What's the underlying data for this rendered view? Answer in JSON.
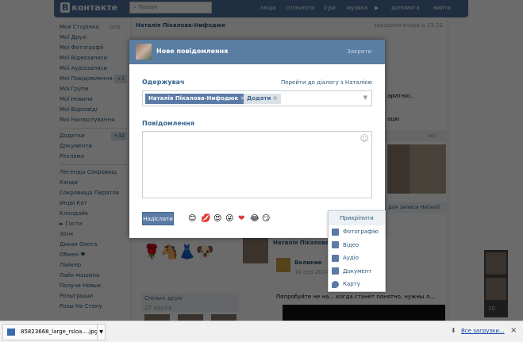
{
  "header": {
    "logo": "В",
    "logo_text": "контакте",
    "search_placeholder": "Пошук",
    "nav": [
      "люди",
      "спільноти",
      "ігри",
      "музика",
      "допомога",
      "вийти"
    ]
  },
  "menu": {
    "edit": "ред.",
    "items": [
      {
        "label": "Моя Сторінка"
      },
      {
        "label": "Мої Друзі"
      },
      {
        "label": "Мої Фотографії"
      },
      {
        "label": "Мої Відеозаписи"
      },
      {
        "label": "Мої Аудіозаписи"
      },
      {
        "label": "Мої Повідомлення",
        "count": "+1"
      },
      {
        "label": "Мої Групи"
      },
      {
        "label": "Мої Новини"
      },
      {
        "label": "Мої Відповіді"
      },
      {
        "label": "Мої Налаштування"
      }
    ],
    "apps": [
      {
        "label": "Додатки",
        "count": "+32"
      },
      {
        "label": "Документи"
      },
      {
        "label": "Реклама"
      }
    ],
    "games": [
      "Легенды Сокровищ",
      "Кэнди",
      "Сокровища Пиратов",
      "Инди Кот",
      "Клондайк",
      "► Гости",
      "Зонк",
      "Дикая Охота",
      "Обмен ♥",
      "Лайкер",
      "Лайк-машина",
      "Получи Новых",
      "Розыгрыши",
      "Розы На Стену"
    ]
  },
  "profile": {
    "name": "Наталія Пікалова-Нифодюк",
    "last_seen": "заходила вчора о 23:23",
    "all": "всі",
    "wall_hint": "для записи Наталії",
    "text1": "аритнос.",
    "text2": "ацю",
    "common_friends": "Спільні друзі",
    "friends_count": "27 друзів",
    "post_author": "Наталія Пікалова",
    "post_source": "Великие",
    "post_date": "10 сер 2014",
    "post_text": "Попробуйте не на... когда станет понятно, нужны л..."
  },
  "modal": {
    "title": "Нове повідомлення",
    "close": "Закрити",
    "recipient_label": "Одержувач",
    "goto_dialog": "Перейти до діалогу з Наталією",
    "recipient": "Наталія Пікалова-Нифодюк",
    "add": "Додати",
    "message_label": "Повідомлення",
    "send": "Надіслати",
    "emojis": [
      "😊",
      "💋",
      "😍",
      "😜",
      "❤",
      "😂",
      "😏"
    ]
  },
  "attach": {
    "title": "Прикріпити",
    "items": [
      "Фотографію",
      "Відео",
      "Аудіо",
      "Документ",
      "Карту"
    ]
  },
  "sidebar_right": {
    "count": "10"
  },
  "download": {
    "file": "85823668_large_rsloa....jpg",
    "all": "Все загрузки...",
    "close": "×"
  }
}
